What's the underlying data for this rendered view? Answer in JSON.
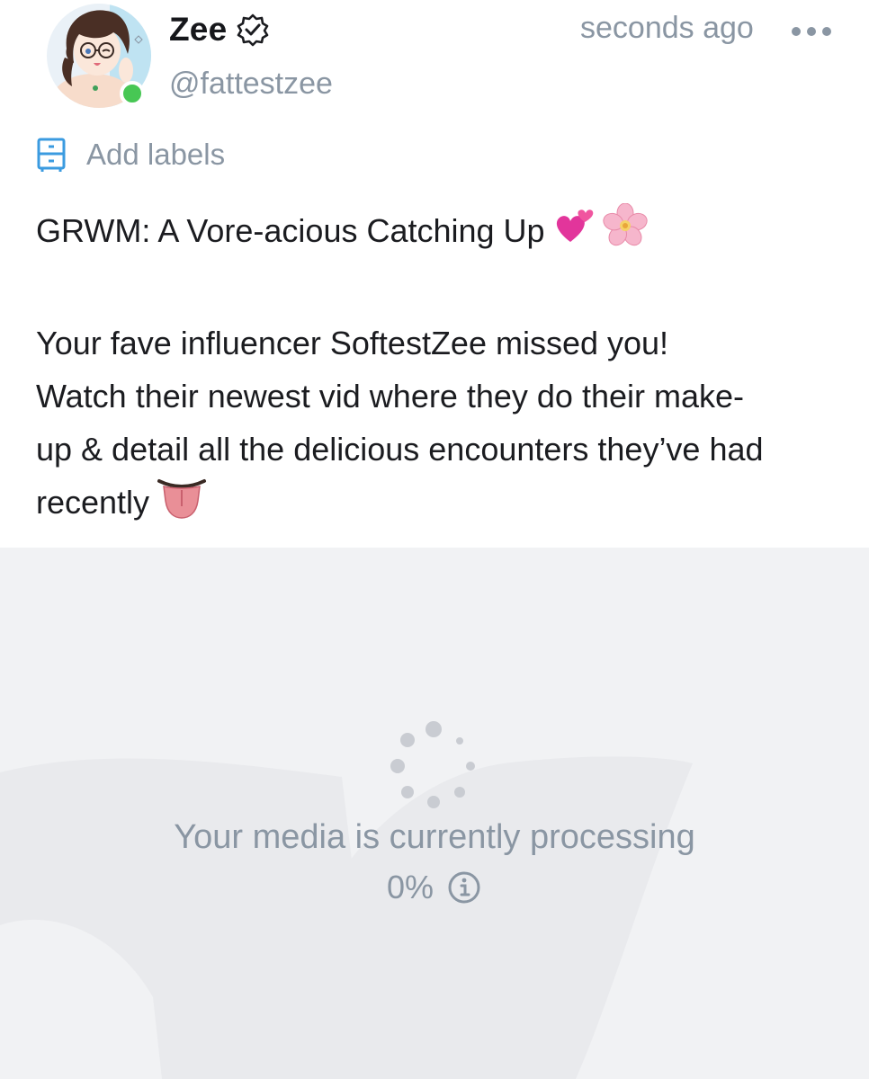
{
  "author": {
    "display_name": "Zee",
    "handle": "@fattestzee",
    "verified_icon": "verified-badge-icon",
    "online": true,
    "avatar": "anime-avatar-image"
  },
  "post": {
    "timestamp": "seconds ago",
    "more_icon": "more-horizontal-icon",
    "labels": {
      "icon": "labels-drawer-icon",
      "text": "Add labels"
    },
    "title": "GRWM: A Vore-acious Catching Up",
    "title_emojis": [
      "two-hearts-emoji",
      "cherry-blossom-emoji"
    ],
    "body_lines": [
      "Your fave influencer SoftestZee missed you!",
      "Watch their newest vid where they do their make-",
      "up & detail all the delicious encounters they’ve had",
      "recently"
    ],
    "body_emoji": "tongue-emoji"
  },
  "media": {
    "status_text": "Your media is currently processing",
    "progress_text": "0%",
    "progress": 0,
    "spinner_icon": "loading-spinner-icon",
    "info_icon": "info-icon"
  },
  "colors": {
    "muted_text": "#8a96a3",
    "labels_icon": "#3b9be0",
    "online": "#47c754",
    "media_bg": "#f1f2f4"
  }
}
